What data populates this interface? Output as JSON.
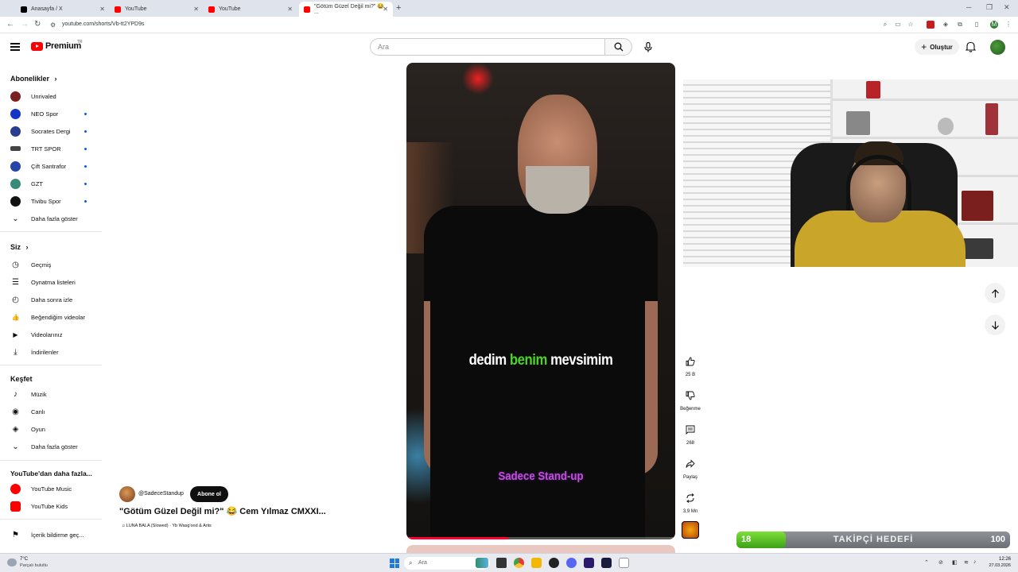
{
  "browser": {
    "tabs": [
      {
        "title": "Anasayfa / X",
        "favicon_color": "#000000",
        "active": false
      },
      {
        "title": "YouTube",
        "favicon_color": "#ff0000",
        "active": false
      },
      {
        "title": "YouTube",
        "favicon_color": "#ff0000",
        "active": false
      },
      {
        "title": "\"Götüm Güzel Değil mi?\" 😂 ...",
        "favicon_color": "#ff0000",
        "active": true
      }
    ],
    "url": "youtube.com/shorts/Vb-tt2YPD9s"
  },
  "header": {
    "logo_text": "Premium",
    "country_code": "TR",
    "search_placeholder": "Ara",
    "create_label": "Oluştur"
  },
  "sidebar": {
    "subscriptions_title": "Abonelikler",
    "subscriptions": [
      {
        "name": "Unrivaled",
        "color": "#7a2020",
        "new": false
      },
      {
        "name": "NEO Spor",
        "color": "#1437c8",
        "new": true
      },
      {
        "name": "Socrates Dergi",
        "color": "#2b3d8f",
        "new": true
      },
      {
        "name": "TRT SPOR",
        "color": "#444444",
        "new": true
      },
      {
        "name": "Çift Santrafor",
        "color": "#2545a8",
        "new": true
      },
      {
        "name": "GZT",
        "color": "#3a8a7a",
        "new": true
      },
      {
        "name": "Tivibu Spor",
        "color": "#111111",
        "new": true
      }
    ],
    "show_more_1": "Daha fazla göster",
    "you_title": "Siz",
    "you_items": [
      {
        "label": "Geçmiş",
        "icon": "history-icon",
        "glyph": "◷"
      },
      {
        "label": "Oynatma listeleri",
        "icon": "playlist-icon",
        "glyph": "☰"
      },
      {
        "label": "Daha sonra izle",
        "icon": "clock-icon",
        "glyph": "◴"
      },
      {
        "label": "Beğendiğim videolar",
        "icon": "thumbs-up-icon",
        "glyph": "👍"
      },
      {
        "label": "Videolarınız",
        "icon": "my-videos-icon",
        "glyph": "▶"
      },
      {
        "label": "İndirilenler",
        "icon": "download-icon",
        "glyph": "⤓"
      }
    ],
    "explore_title": "Keşfet",
    "explore_items": [
      {
        "label": "Müzik",
        "icon": "music-icon",
        "glyph": "♪"
      },
      {
        "label": "Canlı",
        "icon": "live-icon",
        "glyph": "◉"
      },
      {
        "label": "Oyun",
        "icon": "gaming-icon",
        "glyph": "◈"
      }
    ],
    "show_more_2": "Daha fazla göster",
    "more_title": "YouTube'dan daha fazla...",
    "more_items": [
      {
        "label": "YouTube Music",
        "color": "#ff0000"
      },
      {
        "label": "YouTube Kids",
        "color": "#ff0000"
      }
    ],
    "report_label": "İçerik bildirme geç..."
  },
  "video": {
    "caption_pre": "dedim ",
    "caption_hl": "benim",
    "caption_post": " mevsimim",
    "watermark": "Sadece Stand-up",
    "progress": 0.38,
    "channel": "@SadeceStandup",
    "subscribe_label": "Abone ol",
    "title": "\"Götüm Güzel Değil mi?\" 😂 Cem Yılmaz CMXXI...",
    "music": "LUNA BALA (Slowed) · Yb Wasg'ood & Ariis"
  },
  "actions": {
    "likes": "25 B",
    "dislike_label": "Beğenme",
    "comments": "268",
    "share_label": "Paylaş",
    "remix_count": "3,9 Mn"
  },
  "goal": {
    "current": "18",
    "label": "TAKİPÇİ HEDEFİ",
    "max": "100",
    "fraction": 0.18
  },
  "taskbar": {
    "temp": "7°C",
    "weather": "Parçalı bulutlu",
    "search_placeholder": "Ara",
    "time": "12:26",
    "date": "27.03.2026"
  }
}
